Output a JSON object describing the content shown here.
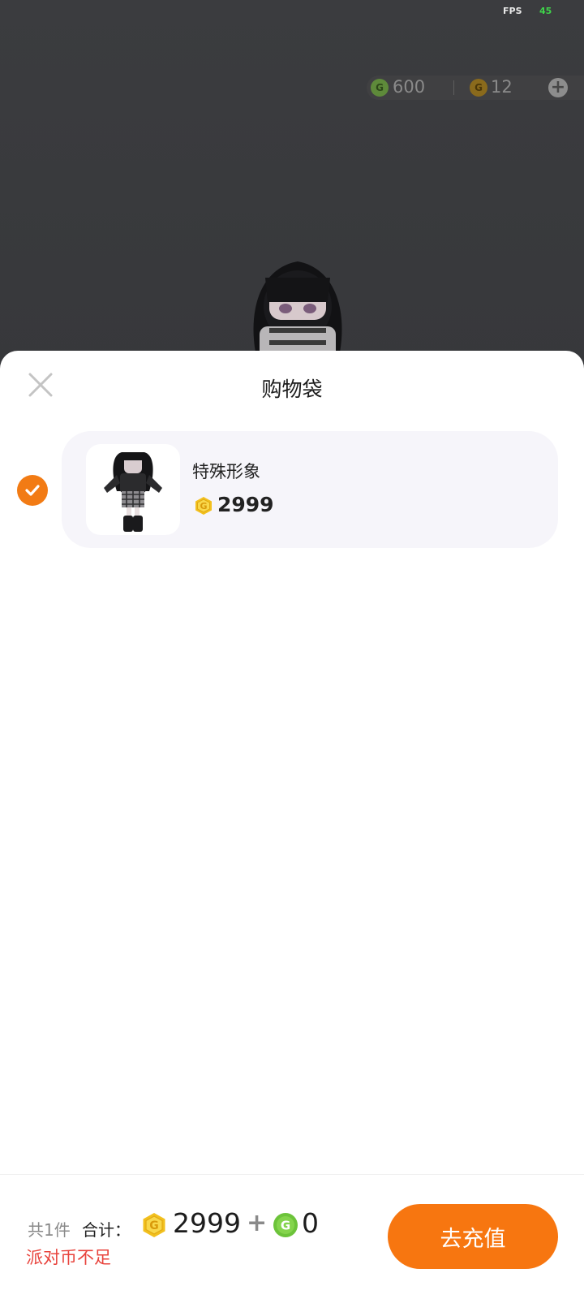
{
  "hud": {
    "fps_label": "FPS",
    "fps_value": "45",
    "green_coin_balance": "600",
    "gold_coin_balance": "12",
    "coin_glyph": "G"
  },
  "sheet": {
    "title": "购物袋",
    "close_icon": "close-icon"
  },
  "cart": {
    "items": [
      {
        "name": "特殊形象",
        "price": "2999",
        "currency": "gold-coin-icon",
        "selected": true
      }
    ]
  },
  "footer": {
    "count_text": "共1件",
    "total_label": "合计：",
    "gold_total": "2999",
    "plus": "+",
    "green_total": "0",
    "warning_text": "派对币不足",
    "recharge_button": "去充值"
  },
  "colors": {
    "accent_orange": "#f77610",
    "gold_coin": "#f2c01e",
    "green_coin": "#6cc33a",
    "warning_red": "#e8433c"
  }
}
